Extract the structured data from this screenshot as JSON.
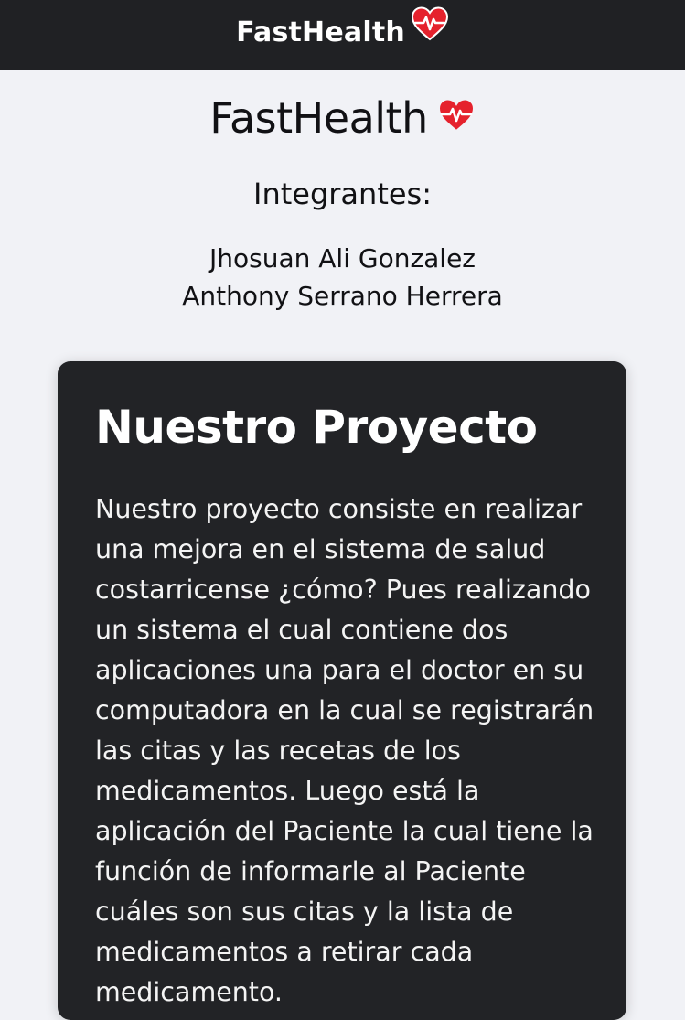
{
  "nav": {
    "brand": "FastHealth",
    "brand_icon": "heart-pulse-icon"
  },
  "hero": {
    "title": "FastHealth",
    "title_icon": "heart-pulse-icon",
    "members_heading": "Integrantes:",
    "members": [
      "Jhosuan Ali Gonzalez",
      "Anthony Serrano Herrera"
    ]
  },
  "project": {
    "title": "Nuestro Proyecto",
    "description": "Nuestro proyecto consiste en realizar una mejora en el sistema de salud costarricense ¿cómo? Pues realizando un sistema el cual contiene dos aplicaciones una para el doctor en su computadora en la cual se registrarán las citas y las recetas de los medicamentos. Luego está la aplicación del Paciente la cual tiene la función de informarle al Paciente cuáles son sus citas y la lista de medicamentos a retirar cada medicamento."
  },
  "colors": {
    "topbar_bg": "#202124",
    "page_bg": "#f1f2f6",
    "card_bg": "#222326",
    "heart_red": "#e5222d"
  }
}
